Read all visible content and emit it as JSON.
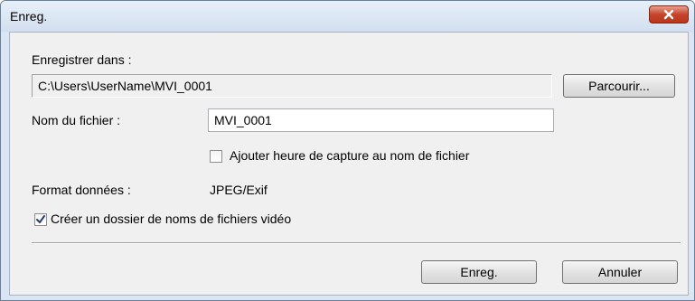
{
  "window": {
    "title": "Enreg."
  },
  "save_in": {
    "label": "Enregistrer dans :",
    "path": "C:\\Users\\UserName\\MVI_0001",
    "browse_label": "Parcourir..."
  },
  "file_name": {
    "label": "Nom du fichier :",
    "value": "MVI_0001"
  },
  "add_time_option": {
    "label": "Ajouter heure de capture au nom de fichier",
    "checked": false
  },
  "data_format": {
    "label": "Format données :",
    "value": "JPEG/Exif"
  },
  "create_folder_option": {
    "label": "Créer un dossier de noms de fichiers vidéo",
    "checked": true
  },
  "buttons": {
    "save_label": "Enreg.",
    "cancel_label": "Annuler"
  },
  "colors": {
    "title_bar": "#d2dff0",
    "close_button": "#c7452b",
    "dialog_body": "#f0f0f0"
  },
  "icons": {
    "close": "close-icon",
    "checkmark": "checkmark-icon"
  }
}
